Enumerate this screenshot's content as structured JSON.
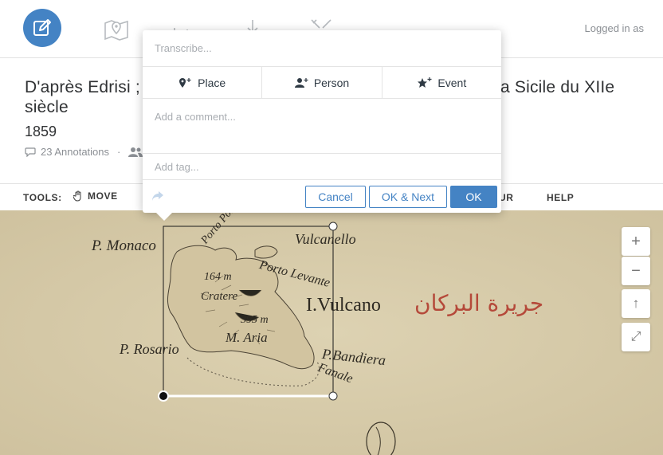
{
  "header": {
    "logged_in": "Logged in as"
  },
  "document": {
    "title_left": "D'après Edrisi ; e",
    "title_right": "a Sicile du XIIe",
    "title_line2": "siècle",
    "year": "1859",
    "annotations": "23 Annotations",
    "separator": "·",
    "contrib_fragment": "N"
  },
  "toolbar": {
    "label": "TOOLS:",
    "move": "MOVE",
    "tour_fragment": "UR",
    "help": "HELP"
  },
  "popup": {
    "transcribe_placeholder": "Transcribe...",
    "place": "Place",
    "person": "Person",
    "event": "Event",
    "comment_placeholder": "Add a comment...",
    "tag_placeholder": "Add tag...",
    "cancel": "Cancel",
    "ok_next": "OK & Next",
    "ok": "OK"
  },
  "map_labels": {
    "monaco": "P. Monaco",
    "vulcanello": "Vulcanello",
    "porto_ponente": "Porto Pon",
    "porto_levante": "Porto Levante",
    "alt1": "164 m",
    "cratere": "Cratere",
    "island": "I.Vulcano",
    "arabic": "جريرة البركان",
    "alt2": "395 m",
    "m_aria": "M. Aria",
    "rosario": "P. Rosario",
    "bandiera": "P.Bandiera",
    "fanale": "Fanale"
  },
  "zoom": {
    "in": "+",
    "out": "−",
    "home": "↑",
    "full": "⤢"
  },
  "colors": {
    "accent": "#4483c4",
    "map_bg": "#d9cdac",
    "arabic_red": "#b5493a"
  }
}
